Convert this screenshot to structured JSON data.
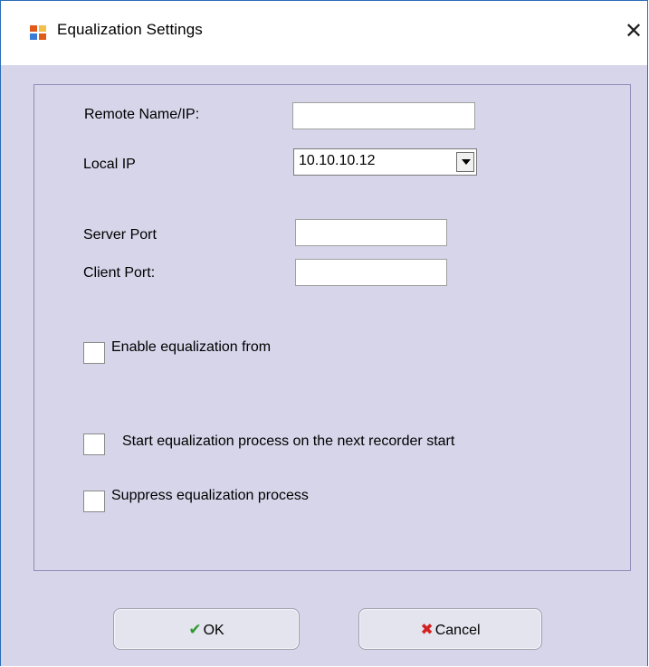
{
  "window": {
    "title": "Equalization Settings",
    "close_symbol": "✕",
    "app_icon": "window-app-icon"
  },
  "form": {
    "remote_name_label": "Remote Name/IP:",
    "remote_name_value": "",
    "local_ip_label": "Local IP",
    "local_ip_value": "10.10.10.12",
    "server_port_label": "Server Port",
    "server_port_value": "",
    "client_port_label": "Client Port:",
    "client_port_value": ""
  },
  "checkboxes": {
    "enable_from_label": "Enable equalization from",
    "enable_from_checked": false,
    "start_next_label": "Start equalization process on the next recorder start",
    "start_next_checked": false,
    "suppress_label": "Suppress equalization process",
    "suppress_checked": false
  },
  "buttons": {
    "ok_label": "OK",
    "ok_icon": "checkmark-icon",
    "ok_icon_color": "#2e9a2e",
    "cancel_label": "Cancel",
    "cancel_icon": "x-icon",
    "cancel_icon_color": "#d42020"
  }
}
